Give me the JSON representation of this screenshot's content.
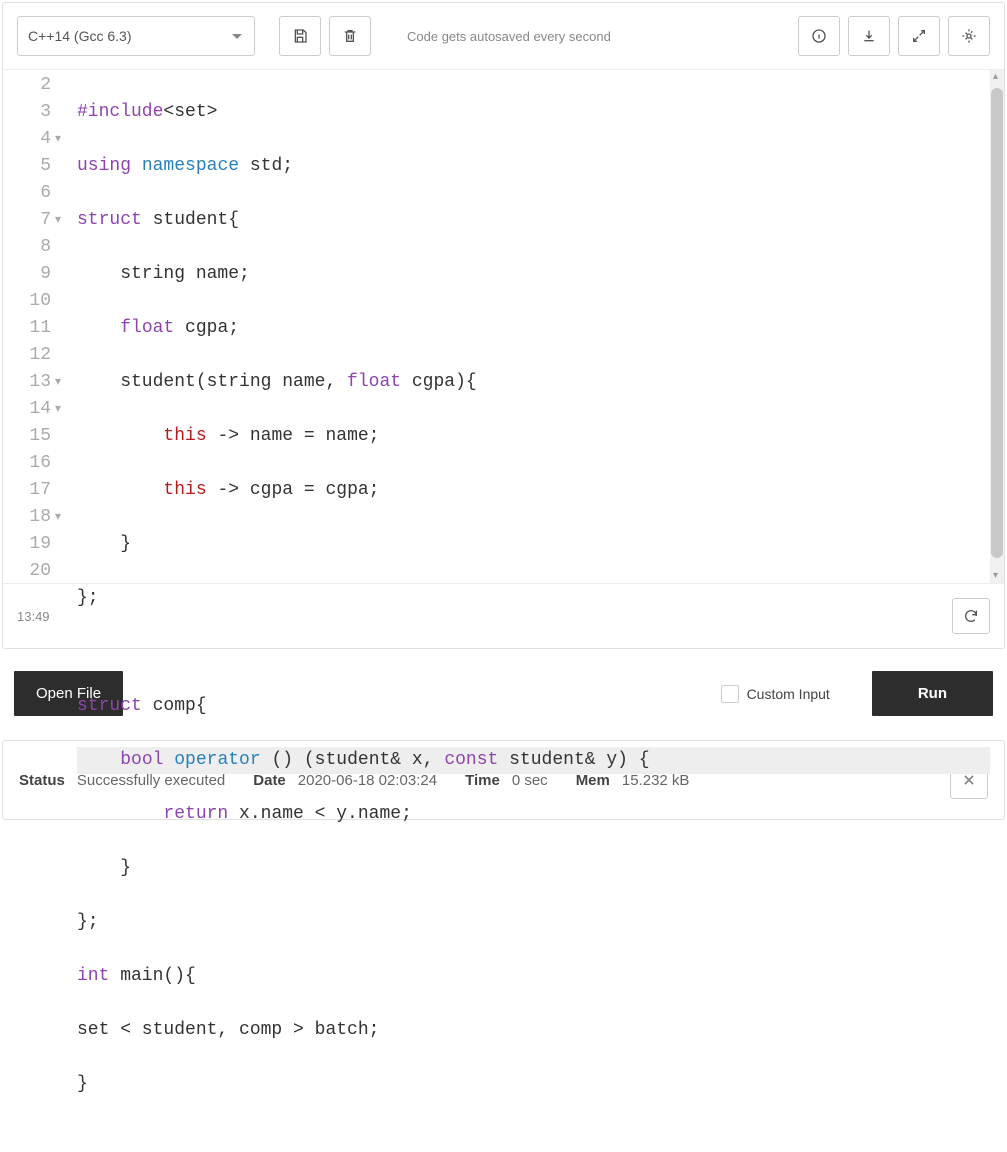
{
  "toolbar": {
    "language": "C++14 (Gcc 6.3)",
    "autosave": "Code gets autosaved every second"
  },
  "editor": {
    "gutter": [
      "2",
      "3",
      "4",
      "5",
      "6",
      "7",
      "8",
      "9",
      "10",
      "11",
      "12",
      "13",
      "14",
      "15",
      "16",
      "17",
      "18",
      "19",
      "20"
    ],
    "time": "13:49"
  },
  "actions": {
    "open_file": "Open File",
    "custom_input": "Custom Input",
    "run": "Run"
  },
  "result": {
    "status_label": "Status",
    "status_value": "Successfully executed",
    "date_label": "Date",
    "date_value": "2020-06-18 02:03:24",
    "time_label": "Time",
    "time_value": "0 sec",
    "mem_label": "Mem",
    "mem_value": "15.232 kB"
  },
  "code": {
    "l2_a": "#include",
    "l2_b": "<set>",
    "l3_a": "using",
    "l3_b": "namespace",
    "l3_c": " std;",
    "l4_a": "struct",
    "l4_b": " student{",
    "l5": "    string name;",
    "l6_a": "    ",
    "l6_b": "float",
    "l6_c": " cgpa;",
    "l7_a": "    student(string name, ",
    "l7_b": "float",
    "l7_c": " cgpa){",
    "l8_a": "        ",
    "l8_b": "this",
    "l8_c": " -> name = name;",
    "l9_a": "        ",
    "l9_b": "this",
    "l9_c": " -> cgpa = cgpa;",
    "l10": "    }",
    "l11": "};",
    "l12": "",
    "l13_a": "struct",
    "l13_b": " comp{",
    "l14_a": "    ",
    "l14_b": "bool",
    "l14_c": " ",
    "l14_d": "operator",
    "l14_e": " () (student& x, ",
    "l14_f": "const",
    "l14_g": " student& y) {",
    "l15_a": "        ",
    "l15_b": "return",
    "l15_c": " x.name < y.name;",
    "l16": "    }",
    "l17": "};",
    "l18_a": "int",
    "l18_b": " main(){",
    "l19": "set < student, comp > batch;",
    "l20": "}"
  }
}
